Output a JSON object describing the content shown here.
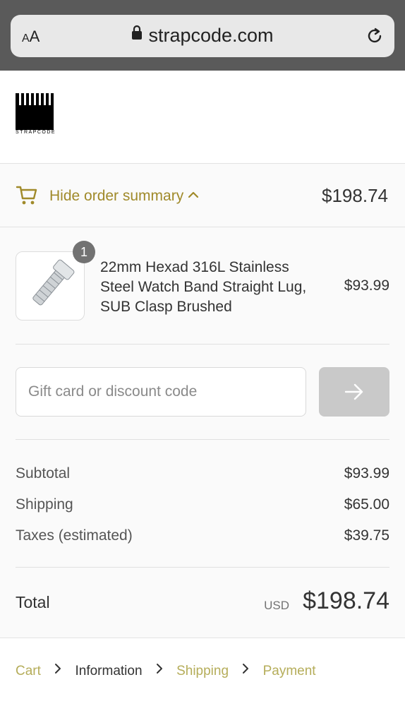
{
  "browser": {
    "text_size_label_small": "A",
    "text_size_label_large": "A",
    "url": "strapcode.com"
  },
  "logo": {
    "text": "STRAPCODE"
  },
  "summary": {
    "toggle_label": "Hide order summary",
    "toggle_total": "$198.74"
  },
  "line_items": [
    {
      "name": "22mm Hexad 316L Stainless Steel Watch Band Straight Lug, SUB Clasp Brushed",
      "quantity": "1",
      "price": "$93.99"
    }
  ],
  "discount": {
    "placeholder": "Gift card or discount code"
  },
  "costs": {
    "subtotal_label": "Subtotal",
    "subtotal_value": "$93.99",
    "shipping_label": "Shipping",
    "shipping_value": "$65.00",
    "taxes_label": "Taxes (estimated)",
    "taxes_value": "$39.75"
  },
  "total": {
    "label": "Total",
    "currency": "USD",
    "value": "$198.74"
  },
  "breadcrumb": [
    {
      "label": "Cart"
    },
    {
      "label": "Information"
    },
    {
      "label": "Shipping"
    },
    {
      "label": "Payment"
    }
  ],
  "colors": {
    "accent": "#a08a2a",
    "breadcrumb_link": "#b5ad5a",
    "browser_bar": "#5a5a5a",
    "button_disabled": "#c9c9c9"
  }
}
